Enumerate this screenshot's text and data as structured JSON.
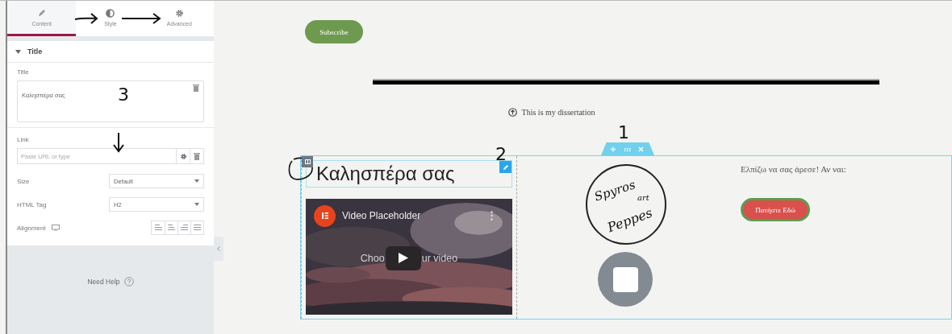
{
  "panel": {
    "tabs": [
      {
        "label": "Content",
        "selected": true
      },
      {
        "label": "Style",
        "selected": false
      },
      {
        "label": "Advanced",
        "selected": false
      }
    ],
    "section": {
      "title": "Title",
      "expanded": true
    },
    "title_field": {
      "label": "Title",
      "value": "Καλησπέρα σας"
    },
    "link_field": {
      "label": "Link",
      "placeholder": "Paste URL or type"
    },
    "size_field": {
      "label": "Size",
      "value": "Default"
    },
    "tag_field": {
      "label": "HTML Tag",
      "value": "H2"
    },
    "alignment": {
      "label": "Alignment"
    },
    "help": "Need Help"
  },
  "canvas": {
    "subscribe": "Subscribe",
    "dissertation": "This is my dissertation",
    "heading": "Καλησπέρα σας",
    "video": {
      "title": "Video Placeholder",
      "caption_before": "Choo",
      "caption_after": "ur video"
    },
    "logo": {
      "line_1": "Spyros",
      "line_2": "art",
      "line_3": "Peppes"
    },
    "paragraph": "Ελπίζω να σας άρεσε! Αν ναι:",
    "button": "Πατήστε Εδώ"
  },
  "annotations": [
    {
      "text": "1"
    },
    {
      "text": "2"
    },
    {
      "text": "3"
    }
  ]
}
